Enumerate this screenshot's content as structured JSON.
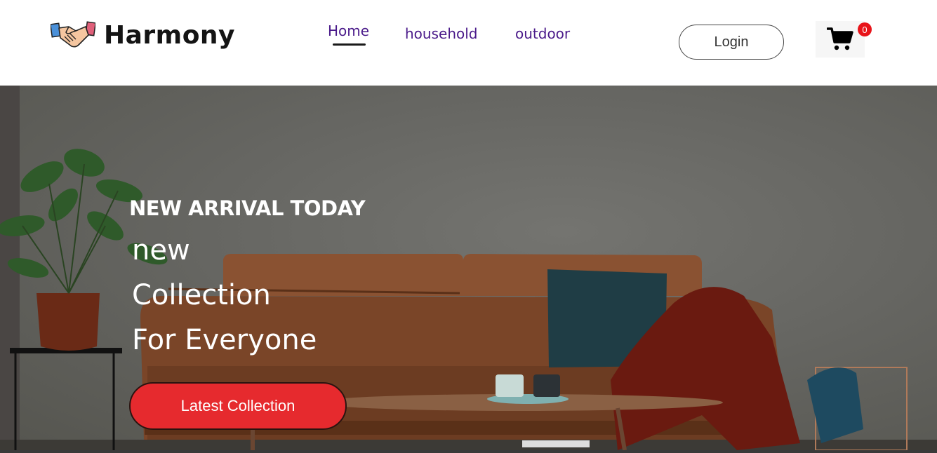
{
  "brand": {
    "name": "Harmony",
    "logo_icon": "handshake-icon"
  },
  "nav": {
    "items": [
      {
        "label": "Home",
        "active": true
      },
      {
        "label": "household",
        "active": false
      },
      {
        "label": "outdoor",
        "active": false
      }
    ]
  },
  "header": {
    "login_label": "Login",
    "cart_count": "0",
    "cart_icon": "shopping-cart-icon"
  },
  "hero": {
    "eyebrow": "NEW ARRIVAL TODAY",
    "lines": [
      "new",
      "Collection",
      "For Everyone"
    ],
    "cta_label": "Latest Collection"
  },
  "colors": {
    "nav_link": "#4a1a8a",
    "cta_background": "#e62a2e",
    "badge": "#e8141a"
  }
}
